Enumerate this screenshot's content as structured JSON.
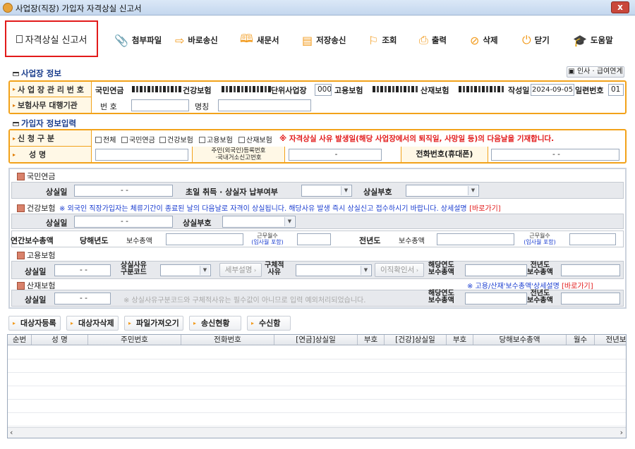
{
  "window": {
    "title": "사업장(직장) 가입자 자격상실 신고서",
    "close": "x"
  },
  "toolbar": {
    "form_title": "자격상실 신고서",
    "buttons": [
      {
        "label": "첨부파일",
        "icon": "attach-icon"
      },
      {
        "label": "바로송신",
        "icon": "send-arrow-icon"
      },
      {
        "label": "새문서",
        "icon": "book-icon"
      },
      {
        "label": "저장송신",
        "icon": "save-icon"
      },
      {
        "label": "조회",
        "icon": "pin-icon"
      },
      {
        "label": "출력",
        "icon": "printer-icon"
      },
      {
        "label": "삭제",
        "icon": "delete-icon"
      },
      {
        "label": "닫기",
        "icon": "power-icon"
      },
      {
        "label": "도움말",
        "icon": "graduation-cap-icon"
      }
    ]
  },
  "workplace": {
    "section_title": "사업장 정보",
    "link_button": "인사 · 급여연계",
    "mgmt_label": "사 업 장 관 리 번 호",
    "pension_label": "국민연금",
    "health_label": "건강보험",
    "unit_label": "단위사업장",
    "unit_value": "000",
    "employment_label": "고용보험",
    "industrial_label": "산재보험",
    "written_label": "작성일",
    "written_value": "2024-09-05",
    "serial_label": "일련번호",
    "serial_value": "01",
    "agent_label": "보험사무 대행기관",
    "agent_no_label": "번 호",
    "agent_name_label": "명칭"
  },
  "subscriber": {
    "section_title": "가입자 정보입력",
    "apply_label": "신  청  구  분",
    "checks": [
      "전체",
      "국민연금",
      "건강보험",
      "고용보험",
      "산재보험"
    ],
    "warning": "※ 자격상실 사유 발생일(해당 사업장에서의 퇴직일, 사망일 등)의 다음날을 기재합니다.",
    "name_label": "성    명",
    "resident_label_1": "주민(외국인)등록번호",
    "resident_label_2": "·국내거소신고번호",
    "resident_value": "-",
    "phone_label": "전화번호(휴대폰)",
    "phone_value": "-          -"
  },
  "pension": {
    "title": "국민연금",
    "loss_date_label": "상실일",
    "loss_date_value": "- -",
    "first_month_label": "초일 취득 · 상실자 납부여부",
    "code_label": "상실부호"
  },
  "health": {
    "title": "건강보험",
    "notice": "※ 외국인 직장가입자는 체류기간이 종료된 날의 다음날로 자격이 상실됩니다. 해당사유 발생 즉시 상실신고 접수하시기 바랍니다. 상세설명",
    "link": "[바로가기]",
    "loss_date_label": "상실일",
    "loss_date_value": "- -",
    "code_label": "상실부호",
    "annual_label": "연간보수총액",
    "current_year_label": "당해년도",
    "total_pay_label": "보수총액",
    "work_months_label": "근무월수",
    "work_months_sub": "(입사월 포함)",
    "prev_year_label": "전년도",
    "prev_total_pay_label": "보수총액",
    "prev_work_months_label": "근무월수",
    "prev_work_months_sub": "(입사월 포함)"
  },
  "employment": {
    "title": "고용보험",
    "loss_date_label": "상실일",
    "loss_date_value": "- -",
    "reason_code_label_1": "상실사유",
    "reason_code_label_2": "구분코드",
    "detail_button": "세부설명",
    "specific_label_1": "구체적",
    "specific_label_2": "사유",
    "transfer_button": "이직확인서",
    "cur_pay_label_1": "해당연도",
    "cur_pay_label_2": "보수총액",
    "prev_pay_label_1": "전년도",
    "prev_pay_label_2": "보수총액"
  },
  "industrial": {
    "title": "산재보험",
    "notice": "※ 고용/산재'보수총액'상세설명",
    "link": "[바로가기]",
    "loss_date_label": "상실일",
    "loss_date_value": "- -",
    "hint": "※ 상실사유구분코드와 구체적사유는 필수값이 아니므로 입력 예외처리되었습니다.",
    "cur_pay_label_1": "해당연도",
    "cur_pay_label_2": "보수총액",
    "prev_pay_label_1": "전년도",
    "prev_pay_label_2": "보수총액"
  },
  "actions": [
    "대상자등록",
    "대상자삭제",
    "파일가져오기",
    "송신현황",
    "수신함"
  ],
  "grid": {
    "columns": [
      "순번",
      "성 명",
      "주민번호",
      "전화번호",
      "[연금]상실일",
      "부호",
      "[건강]상실일",
      "부호",
      "당해보수총액",
      "월수",
      "전년보"
    ]
  }
}
